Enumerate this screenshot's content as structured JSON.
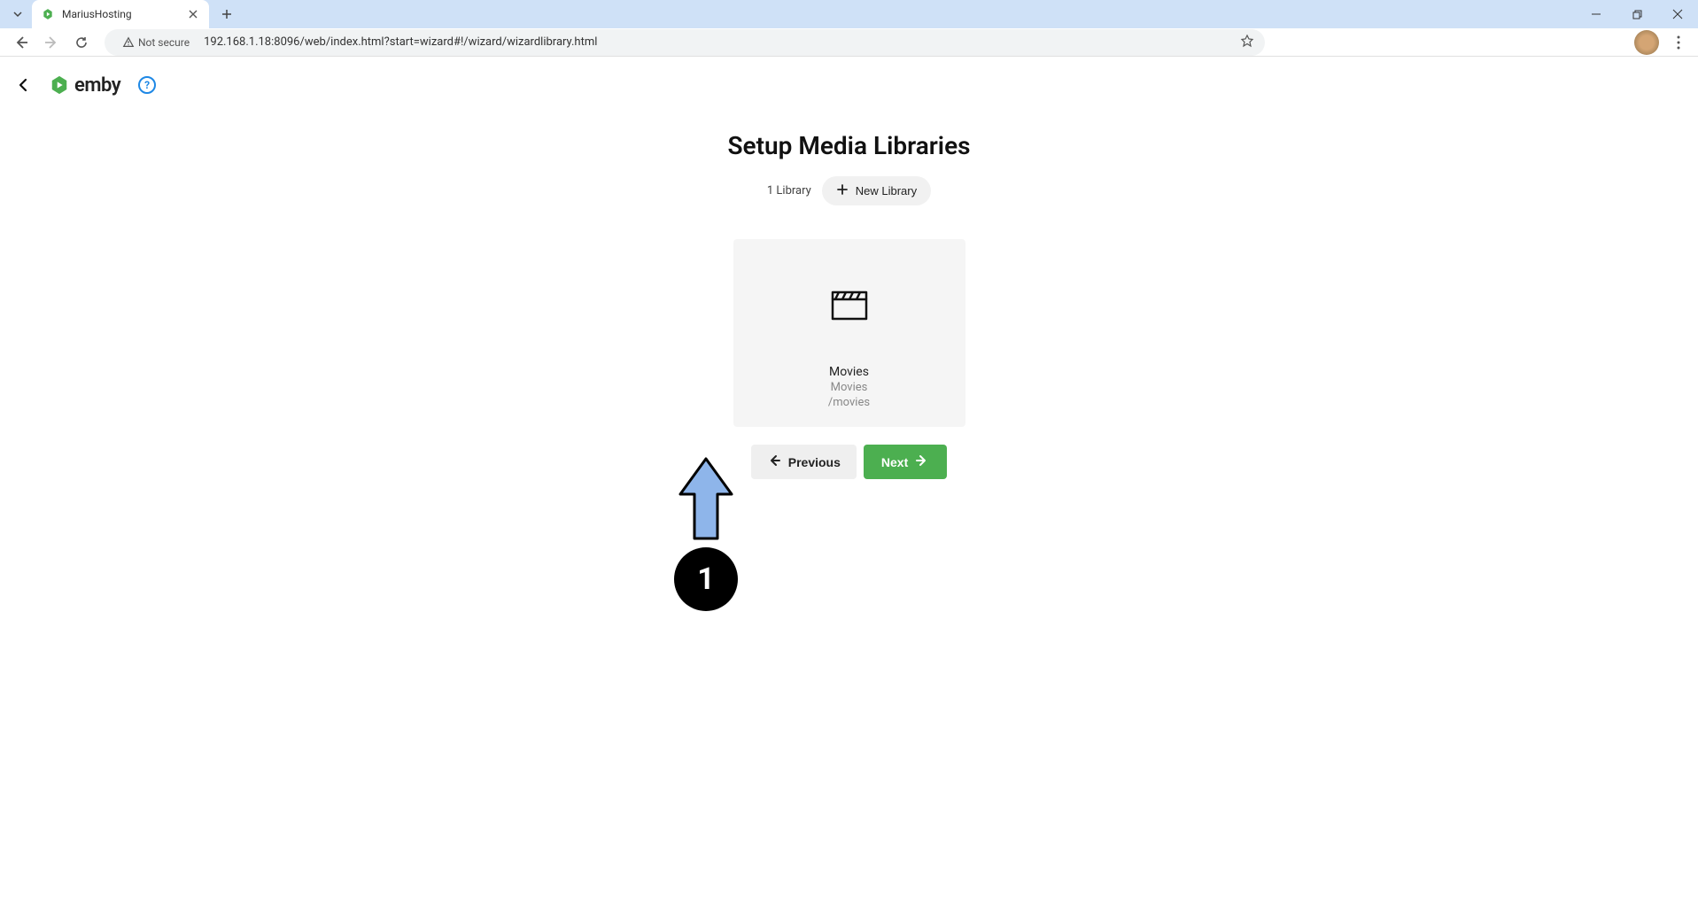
{
  "browser": {
    "tab_title": "MariusHosting",
    "security_label": "Not secure",
    "url": "192.168.1.18:8096/web/index.html?start=wizard#!/wizard/wizardlibrary.html"
  },
  "header": {
    "brand": "emby"
  },
  "wizard": {
    "title": "Setup Media Libraries",
    "library_count_label": "1 Library",
    "new_library_label": "New Library",
    "library": {
      "name": "Movies",
      "type": "Movies",
      "path": "/movies"
    },
    "prev_label": "Previous",
    "next_label": "Next"
  },
  "annotation": {
    "number": "1"
  }
}
